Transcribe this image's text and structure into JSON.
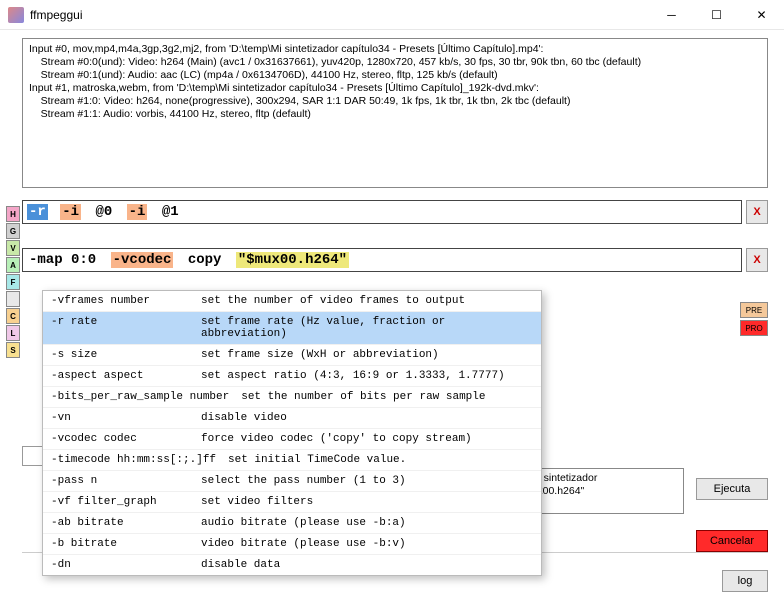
{
  "window": {
    "title": "ffmpeggui"
  },
  "info_lines": [
    "Input #0, mov,mp4,m4a,3gp,3g2,mj2, from 'D:\\temp\\Mi sintetizador capítulo34 - Presets [Último Capítulo].mp4':",
    "    Stream #0:0(und): Video: h264 (Main) (avc1 / 0x31637661), yuv420p, 1280x720, 457 kb/s, 30 fps, 30 tbr, 90k tbn, 60 tbc (default)",
    "    Stream #0:1(und): Audio: aac (LC) (mp4a / 0x6134706D), 44100 Hz, stereo, fltp, 125 kb/s (default)",
    "Input #1, matroska,webm, from 'D:\\temp\\Mi sintetizador capítulo34 - Presets [Último Capítulo]_192k-dvd.mkv':",
    "    Stream #1:0: Video: h264, none(progressive), 300x294, SAR 1:1 DAR 50:49, 1k fps, 1k tbr, 1k tbn, 2k tbc (default)",
    "    Stream #1:1: Audio: vorbis, 44100 Hz, stereo, fltp (default)"
  ],
  "sidebar": [
    {
      "label": "H",
      "bg": "#f4a6c8"
    },
    {
      "label": "G",
      "bg": "#d0d0d0"
    },
    {
      "label": "V",
      "bg": "#c8e8a8"
    },
    {
      "label": "A",
      "bg": "#b8f0b8"
    },
    {
      "label": "F",
      "bg": "#a8e8e8"
    },
    {
      "label": "",
      "bg": "#e8e8e8"
    },
    {
      "label": "C",
      "bg": "#f8d090"
    },
    {
      "label": "L",
      "bg": "#f0c8e8"
    },
    {
      "label": "S",
      "bg": "#f8e090"
    }
  ],
  "cmd1": {
    "tok1": "-r",
    "tok2": "-i",
    "tok3": "@0",
    "tok4": "-i",
    "tok5": "@1"
  },
  "cmd2": {
    "tok1": "-map 0:0",
    "tok2": "-vcodec",
    "tok3": "copy",
    "tok4": "\"$mux00.h264\""
  },
  "mini": {
    "pre": "PRE",
    "pro": "PRO"
  },
  "suggestions": [
    {
      "opt": "-vframes number",
      "desc": "set the number of video frames to output",
      "sel": false
    },
    {
      "opt": "-r rate",
      "desc": "set frame rate (Hz value, fraction or abbreviation)",
      "sel": true
    },
    {
      "opt": "-s size",
      "desc": "set frame size (WxH or abbreviation)",
      "sel": false
    },
    {
      "opt": "-aspect aspect",
      "desc": "set aspect ratio (4:3, 16:9 or 1.3333, 1.7777)",
      "sel": false
    },
    {
      "opt": "-bits_per_raw_sample number",
      "desc": "set the number of bits per raw sample",
      "sel": false,
      "wide": true
    },
    {
      "opt": "-vn",
      "desc": "disable video",
      "sel": false
    },
    {
      "opt": "-vcodec codec",
      "desc": "force video codec ('copy' to copy stream)",
      "sel": false
    },
    {
      "opt": "-timecode hh:mm:ss[:;.]ff",
      "desc": "set initial TimeCode value.",
      "sel": false,
      "wide": true
    },
    {
      "opt": "-pass n",
      "desc": "select the pass number (1 to 3)",
      "sel": false
    },
    {
      "opt": "-vf filter_graph",
      "desc": "set video filters",
      "sel": false
    },
    {
      "opt": "-ab bitrate",
      "desc": "audio bitrate (please use -b:a)",
      "sel": false
    },
    {
      "opt": "-b bitrate",
      "desc": "video bitrate (please use -b:v)",
      "sel": false
    },
    {
      "opt": "-dn",
      "desc": "disable data",
      "sel": false
    }
  ],
  "path_text": "4\" -i \"D:\\temp\\Mi sintetizador\nET\\Desktop\\mux00.h264\"",
  "buttons": {
    "execute": "Ejecuta",
    "cancel": "Cancelar",
    "log": "log",
    "close": "X"
  }
}
